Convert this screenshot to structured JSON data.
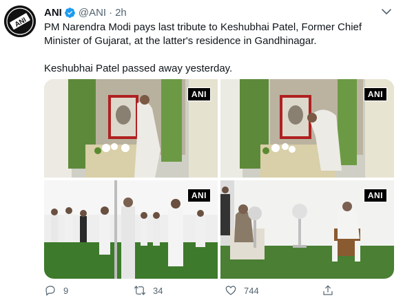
{
  "tweet": {
    "author_name": "ANI",
    "author_handle": "@ANI",
    "separator": "·",
    "time": "2h",
    "avatar_text": "ANI",
    "text_line1": "PM Narendra Modi pays last tribute to Keshubhai Patel, Former Chief Minister of Gujarat, at the latter's residence in Gandhinagar.",
    "text_line2": "Keshubhai Patel passed away yesterday.",
    "photos": [
      {
        "watermark": "ANI"
      },
      {
        "watermark": "ANI"
      },
      {
        "watermark": "ANI"
      },
      {
        "watermark": "ANI"
      }
    ],
    "actions": {
      "reply_count": "9",
      "retweet_count": "34",
      "like_count": "744"
    },
    "colors": {
      "verified": "#1d9bf0",
      "icon_gray": "#536471"
    }
  }
}
